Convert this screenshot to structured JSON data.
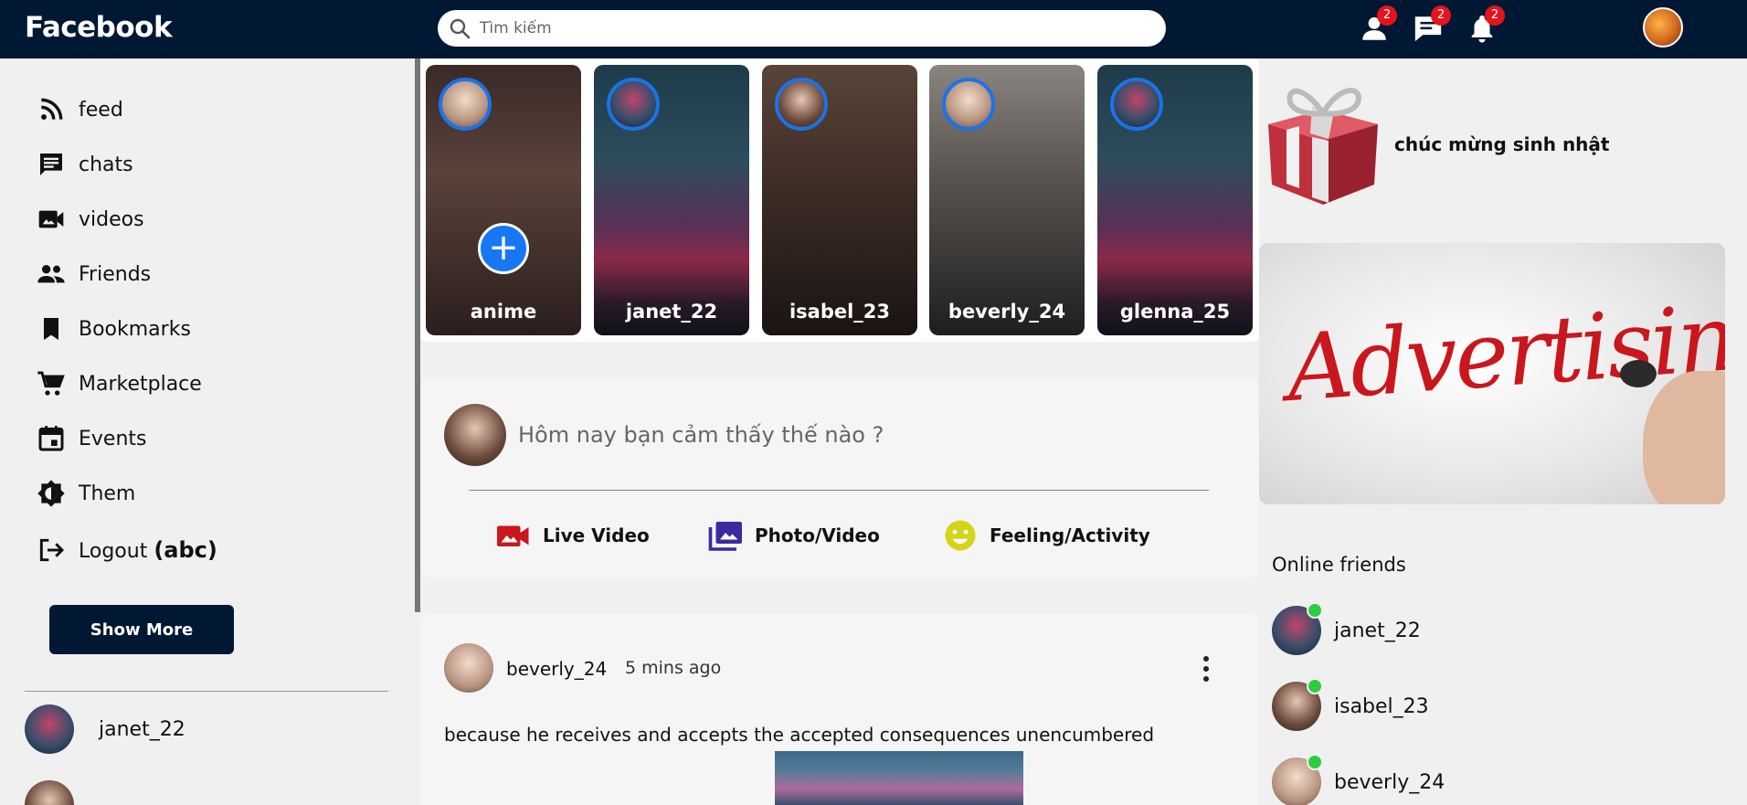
{
  "header": {
    "brand": "Facebook",
    "search_placeholder": "Tìm kiếm",
    "friend_requests_count": "2",
    "messages_count": "2",
    "notifications_count": "2"
  },
  "sidebar": {
    "items": [
      {
        "label": "feed",
        "icon": "rss-icon"
      },
      {
        "label": "chats",
        "icon": "chat-icon"
      },
      {
        "label": "videos",
        "icon": "video-camera-icon"
      },
      {
        "label": "Friends",
        "icon": "people-icon"
      },
      {
        "label": "Bookmarks",
        "icon": "bookmark-icon"
      },
      {
        "label": "Marketplace",
        "icon": "cart-icon"
      },
      {
        "label": "Events",
        "icon": "calendar-icon"
      },
      {
        "label": "Them",
        "icon": "brightness-icon"
      }
    ],
    "logout_label": "Logout",
    "logout_user": "(abc)",
    "show_more": "Show More",
    "friends": [
      "janet_22"
    ]
  },
  "stories": [
    {
      "name": "anime"
    },
    {
      "name": "janet_22"
    },
    {
      "name": "isabel_23"
    },
    {
      "name": "beverly_24"
    },
    {
      "name": "glenna_25"
    }
  ],
  "composer": {
    "prompt": "Hôm nay bạn cảm thấy thế nào ?",
    "actions": [
      {
        "label": "Live Video",
        "color": "#c8171d"
      },
      {
        "label": "Photo/Video",
        "color": "#3a2aa0"
      },
      {
        "label": "Feeling/Activity",
        "color": "#d4d41a"
      }
    ]
  },
  "post": {
    "author": "beverly_24",
    "time": "5 mins ago",
    "text": "because he receives and accepts the accepted consequences unencumbered"
  },
  "right": {
    "birthday_text": "chúc mừng sinh nhật",
    "ad_text": "Advertising",
    "online_title": "Online friends",
    "online_friends": [
      "janet_22",
      "isabel_23",
      "beverly_24"
    ]
  },
  "colors": {
    "topbar": "#011834",
    "accent": "#1877f2",
    "badge": "#e4141e",
    "online": "#2ecc40"
  }
}
